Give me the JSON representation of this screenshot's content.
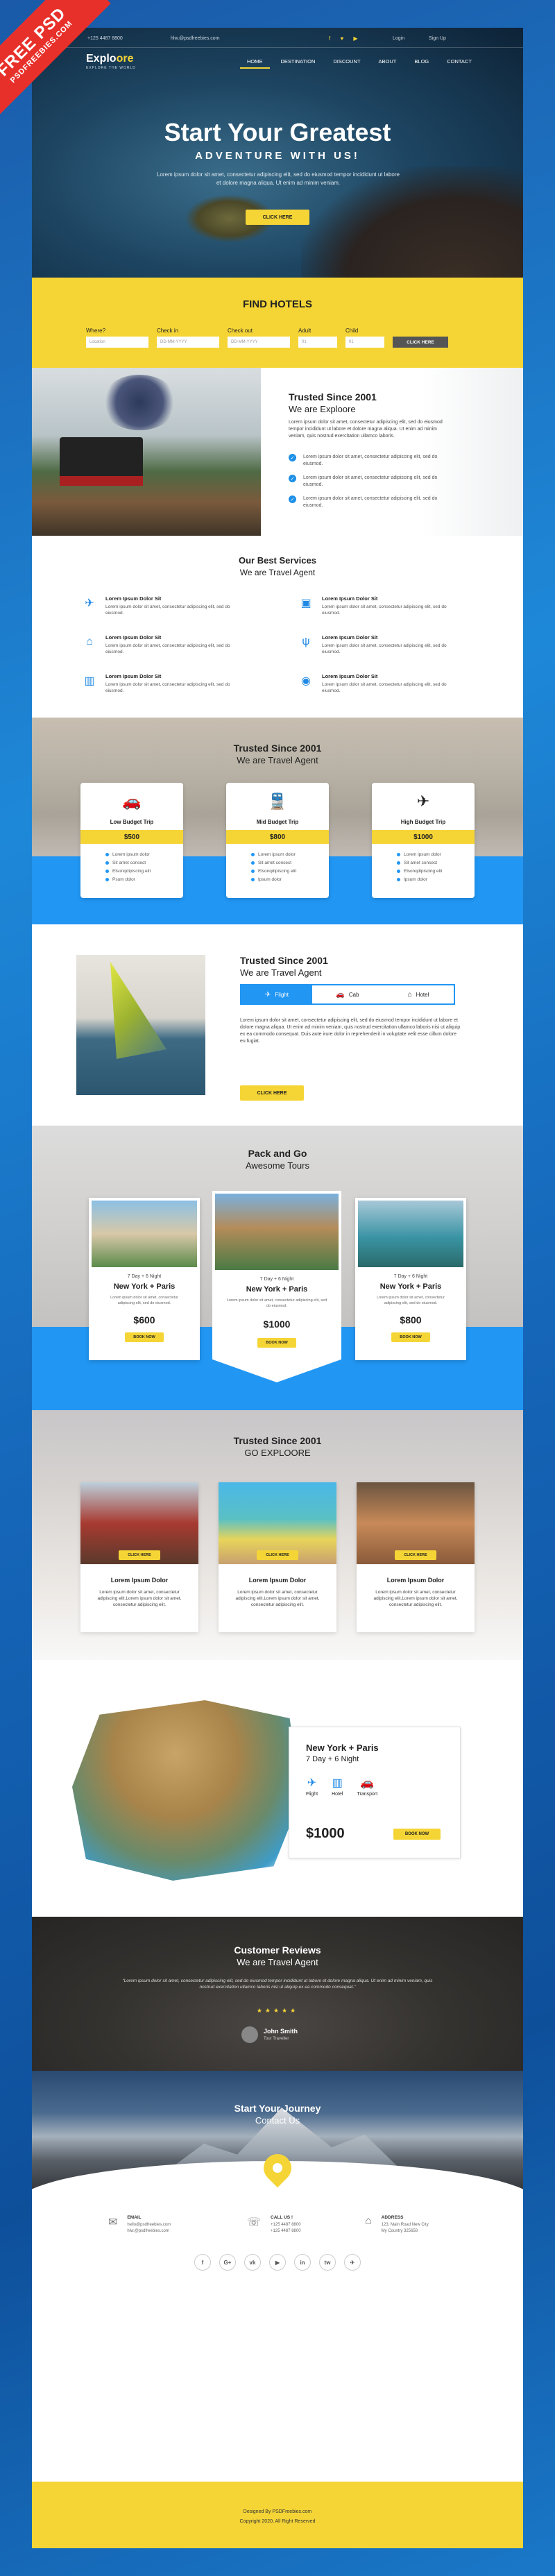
{
  "ribbon": {
    "line1": "FREE PSD",
    "line2": "PSDFREEBIES.COM"
  },
  "topbar": {
    "phone": "+125 4487 8800",
    "email": "hlw.@psdfreebies.com",
    "social": "f ♥ ▶",
    "login": "Login",
    "signup": "Sign Up"
  },
  "brand": {
    "name_a": "Explo",
    "name_b": "ore",
    "tagline": "EXPLORE THE WORLD"
  },
  "nav": [
    "HOME",
    "DESTINATION",
    "DISCOUNT",
    "ABOUT",
    "BLOG",
    "CONTACT"
  ],
  "hero": {
    "title": "Start Your Greatest",
    "subtitle": "ADVENTURE WITH US!",
    "text": "Lorem ipsum dolor sit amet, consectetur adipiscing elit, sed do eiusmod tempor incididunt ut labore et dolore magna aliqua. Ut enim ad minim veniam.",
    "button": "CLICK HERE"
  },
  "find": {
    "title": "FIND HOTELS",
    "fields": [
      {
        "label": "Where?",
        "placeholder": "Location"
      },
      {
        "label": "Check in",
        "placeholder": "DD-MM-YYYY"
      },
      {
        "label": "Check out",
        "placeholder": "DD-MM-YYYY"
      },
      {
        "label": "Adult",
        "placeholder": "01"
      },
      {
        "label": "Child",
        "placeholder": "01"
      }
    ],
    "button": "CLICK HERE"
  },
  "trusted": {
    "title": "Trusted Since 2001",
    "subtitle": "We are Exploore",
    "intro": "Lorem ipsum dolor sit amet, consectetur adipiscing elit, sed do eiusmod tempor incididunt ut labore et dolore magna aliqua. Ut enim ad minim veniam, quis nostrud exercitation ullamco laboris.",
    "items": [
      "Lorem ipsum dolor sit amet, consectetur adipiscing elit, sed do eiusmod.",
      "Lorem ipsum dolor sit amet, consectetur adipiscing elit, sed do eiusmod.",
      "Lorem ipsum dolor sit amet, consectetur adipiscing elit, sed do eiusmod."
    ]
  },
  "services": {
    "title": "Our Best Services",
    "subtitle": "We are Travel Agent",
    "items": [
      {
        "icon": "✈",
        "title": "Lorem Ipsum Dolor Sit",
        "text": "Lorem ipsum dolor sit amet, consectetur adipiscing elit, sed do eiusmod."
      },
      {
        "icon": "⌂",
        "title": "Lorem Ipsum Dolor Sit",
        "text": "Lorem ipsum dolor sit amet, consectetur adipiscing elit, sed do eiusmod."
      },
      {
        "icon": "▥",
        "title": "Lorem Ipsum Dolor Sit",
        "text": "Lorem ipsum dolor sit amet, consectetur adipiscing elit, sed do eiusmod."
      },
      {
        "icon": "▣",
        "title": "Lorem Ipsum Dolor Sit",
        "text": "Lorem ipsum dolor sit amet, consectetur adipiscing elit, sed do eiusmod."
      },
      {
        "icon": "ψ",
        "title": "Lorem Ipsum Dolor Sit",
        "text": "Lorem ipsum dolor sit amet, consectetur adipiscing elit, sed do eiusmod."
      },
      {
        "icon": "◉",
        "title": "Lorem Ipsum Dolor Sit",
        "text": "Lorem ipsum dolor sit amet, consectetur adipiscing elit, sed do eiusmod."
      }
    ]
  },
  "budget": {
    "title": "Trusted Since 2001",
    "subtitle": "We are Travel Agent",
    "cards": [
      {
        "icon": "🚗",
        "title": "Low Budget Trip",
        "price": "$500",
        "features": [
          "Lorem ipsum dolor",
          "Sit amet consect",
          "Elsonqdipiscing elit",
          "Psum dolor"
        ]
      },
      {
        "icon": "🚆",
        "title": "Mid Budget Trip",
        "price": "$800",
        "features": [
          "Lorem ipsum dolor",
          "Sit amet consect",
          "Elsonqdipiscing elit",
          "Ipsum dolor"
        ]
      },
      {
        "icon": "✈",
        "title": "High Budget Trip",
        "price": "$1000",
        "features": [
          "Lorem ipsum dolor",
          "Sit amet consect",
          "Elsonqdipiscing elit",
          "Ipsum dolor"
        ]
      }
    ]
  },
  "agent": {
    "title": "Trusted Since 2001",
    "subtitle": "We are Travel Agent",
    "tabs": [
      {
        "icon": "✈",
        "label": "Flight"
      },
      {
        "icon": "🚗",
        "label": "Cab"
      },
      {
        "icon": "⌂",
        "label": "Hotel"
      }
    ],
    "text": "Lorem ipsum dolor sit amet, consectetur adipiscing elit, sed do eiusmod tempor incididunt ut labore et dolore magna aliqua. Ut enim ad minim veniam, quis nostrud exercitation ullamco laboris nisi ut aliquip ex ea commodo consequat. Duis aute irure dolor in reprehenderit in voluptate velit esse cillum dolore eu fugiat.",
    "button": "CLICK HERE"
  },
  "pack": {
    "title": "Pack and Go",
    "subtitle": "Awesome Tours",
    "cards": [
      {
        "days": "7 Day + 6 Night",
        "city": "New York + Paris",
        "desc": "Lorem ipsum dolor sit amet, consectetur adipiscing elit, sed do eiusmod.",
        "price": "$600",
        "button": "BOOK NOW"
      },
      {
        "days": "7 Day + 6 Night",
        "city": "New York + Paris",
        "desc": "Lorem ipsum dolor sit amet, consectetur adipiscing elit, sed do eiusmod.",
        "price": "$1000",
        "button": "BOOK NOW"
      },
      {
        "days": "7 Day + 6 Night",
        "city": "New York + Paris",
        "desc": "Lorem ipsum dolor sit amet, consectetur adipiscing elit, sed do eiusmod.",
        "price": "$800",
        "button": "BOOK NOW"
      }
    ]
  },
  "go": {
    "title": "Trusted Since 2001",
    "subtitle": "GO EXPLOORE",
    "cards": [
      {
        "button": "CLICK HERE",
        "title": "Lorem Ipsum Dolor",
        "text": "Lorem ipsum dolor sit amet, consectetur adipiscing elit.Lorem ipsum dolor sit amet, consectetur adipiscing elit."
      },
      {
        "button": "CLICK HERE",
        "title": "Lorem Ipsum Dolor",
        "text": "Lorem ipsum dolor sit amet, consectetur adipiscing elit.Lorem ipsum dolor sit amet, consectetur adipiscing elit."
      },
      {
        "button": "CLICK HERE",
        "title": "Lorem Ipsum Dolor",
        "text": "Lorem ipsum dolor sit amet, consectetur adipiscing elit.Lorem ipsum dolor sit amet, consectetur adipiscing elit."
      }
    ]
  },
  "nyp": {
    "title": "New York + Paris",
    "days": "7 Day + 6 Night",
    "icons": [
      {
        "icon": "✈",
        "label": "Flight"
      },
      {
        "icon": "▥",
        "label": "Hotel"
      },
      {
        "icon": "🚗",
        "label": "Transport"
      }
    ],
    "price": "$1000",
    "button": "BOOK NOW"
  },
  "reviews": {
    "title": "Customer Reviews",
    "subtitle": "We are Travel Agent",
    "quote": "“Lorem ipsum dolor sit amet, consectetur adipiscing elit, sed do eiusmod tempor incididunt ut labore et dolore magna aliqua. Ut enim ad minim veniam, quis nostrud exercitation ullamco laboris nisi ut aliquip ex ea commodo consequat.”",
    "stars": "★★★★★",
    "name": "John Smith",
    "role": "Tour Traveller"
  },
  "journey": {
    "title": "Start Your Journey",
    "subtitle": "Contact Us"
  },
  "contact": {
    "groups": [
      {
        "icon": "✉",
        "label": "EMAIL",
        "values": [
          "hello@psdfreebies.com",
          "hlw.@psdfreebies.com"
        ]
      },
      {
        "icon": "☏",
        "label": "CALL US !",
        "values": [
          "+125 4487 8800",
          "+125 4487 8800"
        ]
      },
      {
        "icon": "⌂",
        "label": "ADDRESS",
        "values": [
          "123, Main Road New City",
          "My Country 325658"
        ]
      }
    ],
    "social": [
      "f",
      "G+",
      "vk",
      "▶",
      "in",
      "tw",
      "✈"
    ]
  },
  "footer": {
    "designed": "Designed By PSDFreebies.com",
    "copyright": "Copyright 2020, All Right Reserved"
  }
}
